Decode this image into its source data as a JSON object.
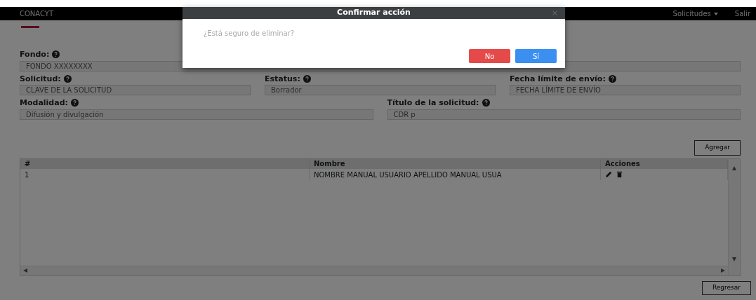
{
  "navbar": {
    "brand": "CONACYT",
    "items": [
      {
        "label": "Solicitudes",
        "dropdown": true
      },
      {
        "label": "Salir",
        "dropdown": false
      }
    ]
  },
  "form": {
    "rows": [
      [
        {
          "label": "Fondo:",
          "value": "FONDO XXXXXXXX"
        }
      ],
      [
        {
          "label": "Solicitud:",
          "value": "CLAVE DE LA SOLICITUD"
        },
        {
          "label": "Estatus:",
          "value": "Borrador"
        },
        {
          "label": "Fecha límite de envío:",
          "value": "FECHA LÍMITE DE ENVÍO"
        }
      ],
      [
        {
          "label": "Modalidad:",
          "value": "Difusión y divulgación"
        },
        {
          "label": "Título de la solicitud:",
          "value": "CDR p"
        }
      ]
    ]
  },
  "add_button": "Agregar",
  "table": {
    "columns": [
      "#",
      "Nombre",
      "Acciones"
    ],
    "rows": [
      {
        "cells": [
          "1",
          "NOMBRE MANUAL USUARIO APELLIDO MANUAL USUA"
        ],
        "actions": [
          {
            "kind": "edit"
          },
          {
            "kind": "delete"
          }
        ]
      }
    ]
  },
  "back_button": "Regresar",
  "modal": {
    "title": "Confirmar acción",
    "close": "×",
    "message": "¿Está seguro de eliminar?",
    "buttons": [
      {
        "label": "No",
        "kind": "danger"
      },
      {
        "label": "Sí",
        "kind": "primary"
      }
    ]
  }
}
